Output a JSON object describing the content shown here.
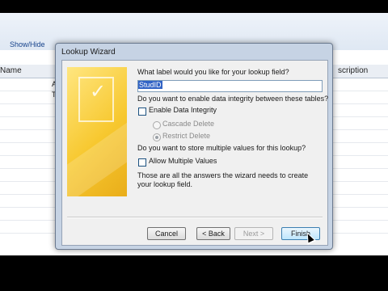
{
  "background_app": {
    "ribbon_group": "Show/Hide",
    "grid_columns": {
      "name": "Name",
      "description": "scription"
    },
    "partial_cells": [
      "A",
      "T"
    ]
  },
  "dialog": {
    "title": "Lookup Wizard",
    "question_label": "What label would you like for your lookup field?",
    "label_value": "StudID",
    "question_integrity": "Do you want to enable data integrity between these tables?",
    "enable_integrity_label": "Enable Data Integrity",
    "enable_integrity_checked": false,
    "cascade_delete_label": "Cascade Delete",
    "restrict_delete_label": "Restrict Delete",
    "restrict_selected": true,
    "question_multiple": "Do you want to store multiple values for this lookup?",
    "allow_multiple_label": "Allow Multiple Values",
    "allow_multiple_checked": false,
    "finish_text": "Those are all the answers the wizard needs to create your lookup field.",
    "buttons": {
      "cancel": "Cancel",
      "back": "< Back",
      "next": "Next >",
      "finish": "Finish"
    }
  },
  "colors": {
    "dialog_frame": "#c6d3e4",
    "wizard_image": "#f7c82f",
    "selection": "#3163c5"
  }
}
